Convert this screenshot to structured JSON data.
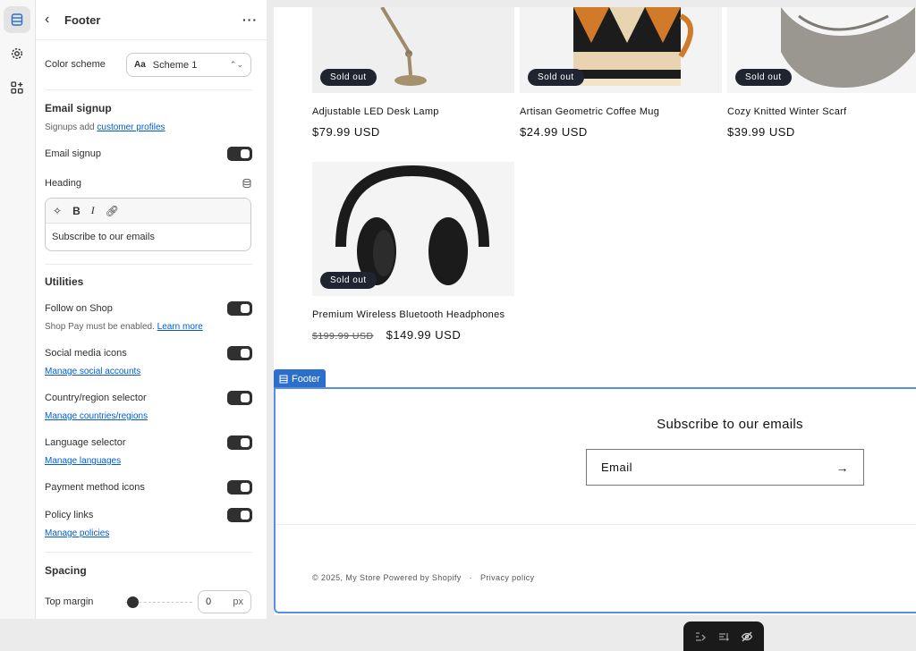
{
  "panel": {
    "title": "Footer",
    "color_scheme": {
      "label": "Color scheme",
      "value": "Scheme 1",
      "icon_text": "Aa"
    },
    "email_signup": {
      "section_title": "Email signup",
      "hint_prefix": "Signups add",
      "hint_link": "customer profiles",
      "toggle_label": "Email signup",
      "heading_label": "Heading",
      "heading_value": "Subscribe to our emails"
    },
    "utilities": {
      "section_title": "Utilities",
      "follow_on_shop": "Follow on Shop",
      "shop_pay_hint": "Shop Pay must be enabled.",
      "learn_more": "Learn more",
      "social_media_icons": "Social media icons",
      "manage_social": "Manage social accounts",
      "country_selector": "Country/region selector",
      "manage_countries": "Manage countries/regions",
      "language_selector": "Language selector",
      "manage_languages": "Manage languages",
      "payment_icons": "Payment method icons",
      "policy_links": "Policy links",
      "manage_policies": "Manage policies"
    },
    "spacing": {
      "section_title": "Spacing",
      "top_margin_label": "Top margin",
      "top_margin_value": "0",
      "unit": "px"
    }
  },
  "products": [
    {
      "name": "Adjustable LED Desk Lamp",
      "price": "$79.99 USD",
      "badge": "Sold out"
    },
    {
      "name": "Artisan Geometric Coffee Mug",
      "price": "$24.99 USD",
      "badge": "Sold out"
    },
    {
      "name": "Cozy Knitted Winter Scarf",
      "price": "$39.99 USD",
      "badge": "Sold out"
    },
    {
      "name": "Premium Wireless Bluetooth Headphones",
      "compare_price": "$199.99 USD",
      "price": "$149.99 USD",
      "badge": "Sold out"
    }
  ],
  "footer": {
    "tag_label": "Footer",
    "subscribe_title": "Subscribe to our emails",
    "email_placeholder": "Email",
    "copyright": "© 2025, My Store Powered by Shopify",
    "privacy": "Privacy policy",
    "separator": "·"
  },
  "colors": {
    "accent": "#2c6ecb",
    "badge_bg": "#1f2430",
    "link": "#005bd3"
  }
}
